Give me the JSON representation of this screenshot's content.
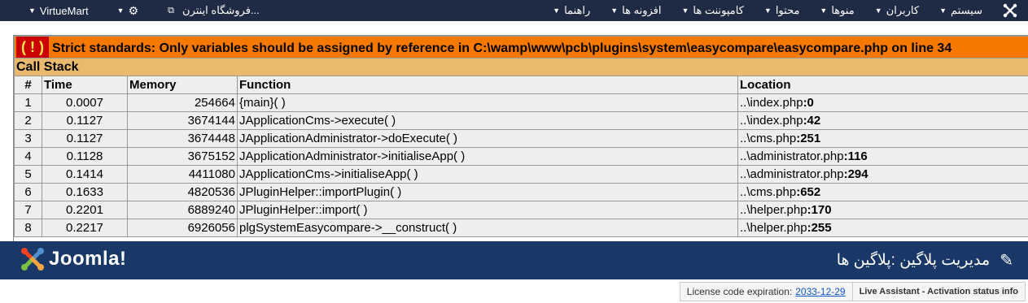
{
  "topbar": {
    "left": {
      "virtuemart": "VirtueMart",
      "store_link": "فروشگاه اینترن..."
    },
    "right_menu": [
      "سیستم",
      "کاربران",
      "منوها",
      "محتوا",
      "کامپوننت ها",
      "افزونه ها",
      "راهنما"
    ]
  },
  "error": {
    "icon": "( ! )",
    "message": "Strict standards: Only variables should be assigned by reference in C:\\wamp\\www\\pcb\\plugins\\system\\easycompare\\easycompare.php on line 34",
    "call_stack_label": "Call Stack",
    "columns": [
      "#",
      "Time",
      "Memory",
      "Function",
      "Location"
    ],
    "rows": [
      {
        "n": "1",
        "time": "0.0007",
        "mem": "254664",
        "fn": "{main}( )",
        "loc_path": "..\\index.php",
        "loc_line": ":0"
      },
      {
        "n": "2",
        "time": "0.1127",
        "mem": "3674144",
        "fn": "JApplicationCms->execute( )",
        "loc_path": "..\\index.php",
        "loc_line": ":42"
      },
      {
        "n": "3",
        "time": "0.1127",
        "mem": "3674448",
        "fn": "JApplicationAdministrator->doExecute( )",
        "loc_path": "..\\cms.php",
        "loc_line": ":251"
      },
      {
        "n": "4",
        "time": "0.1128",
        "mem": "3675152",
        "fn": "JApplicationAdministrator->initialiseApp( )",
        "loc_path": "..\\administrator.php",
        "loc_line": ":116"
      },
      {
        "n": "5",
        "time": "0.1414",
        "mem": "4411080",
        "fn": "JApplicationCms->initialiseApp( )",
        "loc_path": "..\\administrator.php",
        "loc_line": ":294"
      },
      {
        "n": "6",
        "time": "0.1633",
        "mem": "4820536",
        "fn": "JPluginHelper::importPlugin( )",
        "loc_path": "..\\cms.php",
        "loc_line": ":652"
      },
      {
        "n": "7",
        "time": "0.2201",
        "mem": "6889240",
        "fn": "JPluginHelper::import( )",
        "loc_path": "..\\helper.php",
        "loc_line": ":170"
      },
      {
        "n": "8",
        "time": "0.2217",
        "mem": "6926056",
        "fn": "plgSystemEasycompare->__construct( )",
        "loc_path": "..\\helper.php",
        "loc_line": ":255"
      }
    ]
  },
  "titlebar": {
    "brand": "Joomla!",
    "title": "مدیریت پلاگین :پلاگین ها"
  },
  "statusbar": {
    "license_label": "License code expiration:",
    "license_date": "2033-12-29",
    "live_assistant": "Live Assistant - Activation status info"
  },
  "colors": {
    "topbar_bg": "#1f2a44",
    "error_orange": "#f57900",
    "callstack_tan": "#e9b96e",
    "row_bg": "#eeeeec",
    "titlebar_bg": "#1a3867"
  }
}
